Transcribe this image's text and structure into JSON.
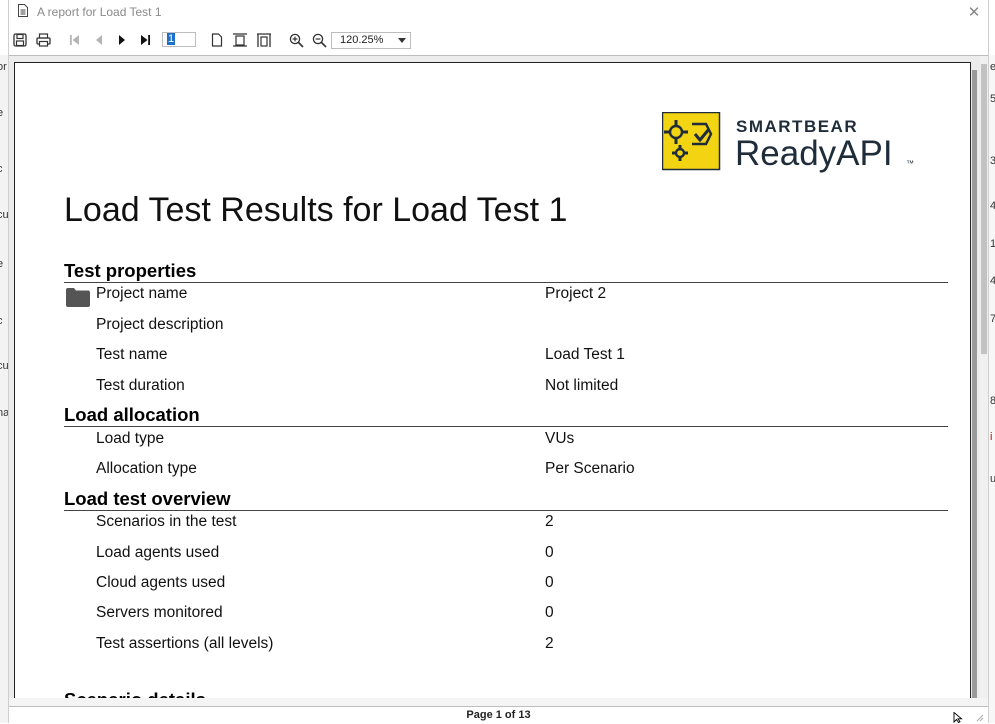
{
  "window": {
    "title": "A report for Load Test 1",
    "close_label": "✕"
  },
  "background_app": {
    "left_fragments": [
      "or",
      "e",
      "c",
      "cu",
      "e",
      "c",
      "cu",
      "na"
    ],
    "right_fragments": [
      "e",
      "5",
      "3",
      "4",
      "1",
      "4",
      "7",
      "8",
      "i",
      "u"
    ]
  },
  "toolbar": {
    "page_number": "1",
    "zoom": "120.25%"
  },
  "report": {
    "logo": {
      "brand_top": "SMARTBEAR",
      "brand_main": "ReadyAPI",
      "trademark": "™",
      "colors": {
        "badge": "#f3d412",
        "ink": "#1f2c3a"
      }
    },
    "title": "Load Test Results for Load Test 1",
    "sections": [
      {
        "heading": "Test properties",
        "rows": [
          {
            "label": "Project name",
            "value": "Project 2"
          },
          {
            "label": "Project description",
            "value": ""
          },
          {
            "label": "Test name",
            "value": "Load Test 1"
          },
          {
            "label": "Test duration",
            "value": "Not limited"
          }
        ]
      },
      {
        "heading": "Load allocation",
        "rows": [
          {
            "label": "Load type",
            "value": "VUs"
          },
          {
            "label": "Allocation type",
            "value": "Per Scenario"
          }
        ]
      },
      {
        "heading": "Load test overview",
        "rows": [
          {
            "label": "Scenarios in the test",
            "value": "2"
          },
          {
            "label": "Load agents used",
            "value": "0"
          },
          {
            "label": "Cloud agents used",
            "value": "0"
          },
          {
            "label": "Servers monitored",
            "value": "0"
          },
          {
            "label": "Test assertions (all levels)",
            "value": "2"
          }
        ]
      }
    ],
    "next_heading_partial": "Scenario details"
  },
  "status": {
    "page_indicator": "Page 1 of 13"
  },
  "icons": {
    "title": "document-icon",
    "save": "save-icon",
    "print": "print-icon",
    "first": "first-page-icon",
    "prev": "previous-page-icon",
    "next": "next-page-icon",
    "last": "last-page-icon",
    "single_page": "single-page-view-icon",
    "page_width": "page-width-icon",
    "whole_page": "whole-page-icon",
    "zoom_in": "zoom-in-icon",
    "zoom_out": "zoom-out-icon",
    "folder": "folder-icon"
  }
}
